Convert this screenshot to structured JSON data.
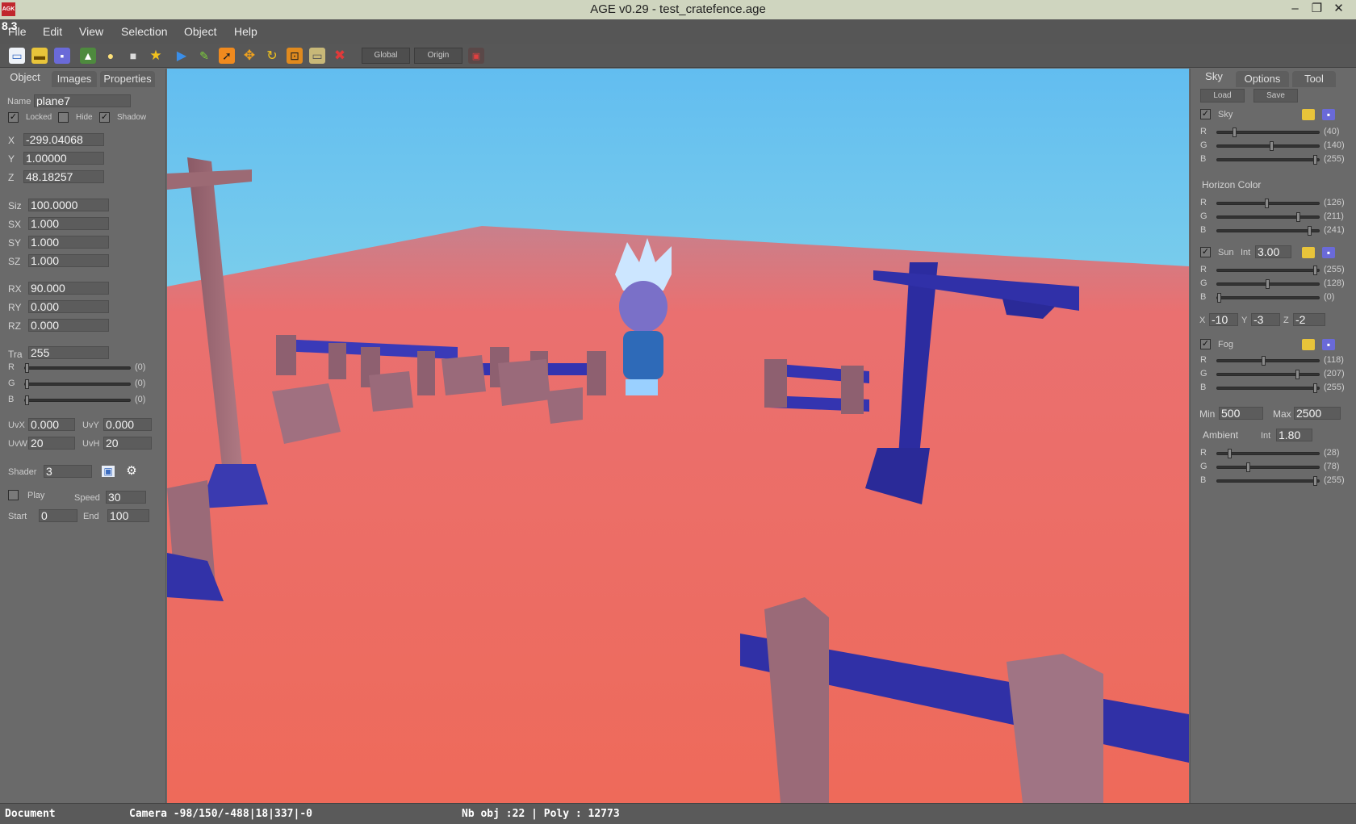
{
  "window": {
    "app_icon": "AGK",
    "title": "AGE v0.29 - test_cratefence.age",
    "fps": "8.3"
  },
  "menu": [
    "File",
    "Edit",
    "View",
    "Selection",
    "Object",
    "Help"
  ],
  "toolbar": {
    "icons": [
      "new-file-icon",
      "open-folder-icon",
      "save-icon",
      "terrain-icon",
      "light-bulb-icon",
      "camera-icon",
      "star-icon",
      "play-icon",
      "pencil-icon",
      "pointer-icon",
      "move-icon",
      "rotate-icon",
      "scale-icon",
      "image-icon",
      "delete-icon"
    ],
    "global_label": "Global",
    "origin_label": "Origin",
    "colors": {
      "play": "#3a8ee8",
      "pencil": "#7ed23a",
      "delete": "#e03a3a",
      "star": "#f2c21e"
    }
  },
  "left": {
    "tabs": [
      "Object",
      "Images",
      "Properties"
    ],
    "name_label": "Name",
    "name_value": "plane7",
    "locked_label": "Locked",
    "locked": true,
    "hide_label": "Hide",
    "hide": false,
    "shadow_label": "Shadow",
    "shadow": true,
    "pos": [
      {
        "label": "X",
        "value": "-299.04068"
      },
      {
        "label": "Y",
        "value": "1.00000"
      },
      {
        "label": "Z",
        "value": "48.18257"
      }
    ],
    "size": [
      {
        "label": "Siz",
        "value": "100.0000"
      },
      {
        "label": "SX",
        "value": "1.000"
      },
      {
        "label": "SY",
        "value": "1.000"
      },
      {
        "label": "SZ",
        "value": "1.000"
      }
    ],
    "rot": [
      {
        "label": "RX",
        "value": "90.000"
      },
      {
        "label": "RY",
        "value": "0.000"
      },
      {
        "label": "RZ",
        "value": "0.000"
      }
    ],
    "tra_label": "Tra",
    "tra_value": "255",
    "color": [
      {
        "label": "R",
        "value": "(0)",
        "level": 0
      },
      {
        "label": "G",
        "value": "(0)",
        "level": 0
      },
      {
        "label": "B",
        "value": "(0)",
        "level": 0
      }
    ],
    "uvx_label": "UvX",
    "uvx": "0.000",
    "uvy_label": "UvY",
    "uvy": "0.000",
    "uvw_label": "UvW",
    "uvw": "20",
    "uvh_label": "UvH",
    "uvh": "20",
    "shader_label": "Shader",
    "shader": "3",
    "play_label": "Play",
    "play": false,
    "speed_label": "Speed",
    "speed": "30",
    "start_label": "Start",
    "start": "0",
    "end_label": "End",
    "end": "100"
  },
  "right": {
    "tabs": [
      "Sky",
      "Options",
      "Tool"
    ],
    "load_label": "Load",
    "save_label": "Save",
    "sky_label": "Sky",
    "sky_enabled": true,
    "sky": [
      {
        "label": "R",
        "value": "(40)",
        "level": 0.157
      },
      {
        "label": "G",
        "value": "(140)",
        "level": 0.549
      },
      {
        "label": "B",
        "value": "(255)",
        "level": 1.0
      }
    ],
    "horizon_label": "Horizon  Color",
    "horizon": [
      {
        "label": "R",
        "value": "(126)",
        "level": 0.494
      },
      {
        "label": "G",
        "value": "(211)",
        "level": 0.827
      },
      {
        "label": "B",
        "value": "(241)",
        "level": 0.945
      }
    ],
    "sun_label": "Sun",
    "sun_enabled": true,
    "sun_int_label": "Int",
    "sun_int": "3.00",
    "sun": [
      {
        "label": "R",
        "value": "(255)",
        "level": 1.0
      },
      {
        "label": "G",
        "value": "(128)",
        "level": 0.502
      },
      {
        "label": "B",
        "value": "(0)",
        "level": 0.0
      }
    ],
    "sun_x_label": "X",
    "sun_x": "-10",
    "sun_y_label": "Y",
    "sun_y": "-3",
    "sun_z_label": "Z",
    "sun_z": "-2",
    "fog_label": "Fog",
    "fog_enabled": true,
    "fog": [
      {
        "label": "R",
        "value": "(118)",
        "level": 0.463
      },
      {
        "label": "G",
        "value": "(207)",
        "level": 0.812
      },
      {
        "label": "B",
        "value": "(255)",
        "level": 1.0
      }
    ],
    "min_label": "Min",
    "min": "500",
    "max_label": "Max",
    "max": "2500",
    "ambient_label": "Ambient",
    "amb_int_label": "Int",
    "amb_int": "1.80",
    "ambient": [
      {
        "label": "R",
        "value": "(28)",
        "level": 0.11
      },
      {
        "label": "G",
        "value": "(78)",
        "level": 0.306
      },
      {
        "label": "B",
        "value": "(255)",
        "level": 1.0
      }
    ]
  },
  "status": {
    "document": "Document",
    "camera": "Camera -98/150/-488|18|337|-0",
    "objects": "Nb obj :22 | Poly : 12773"
  }
}
